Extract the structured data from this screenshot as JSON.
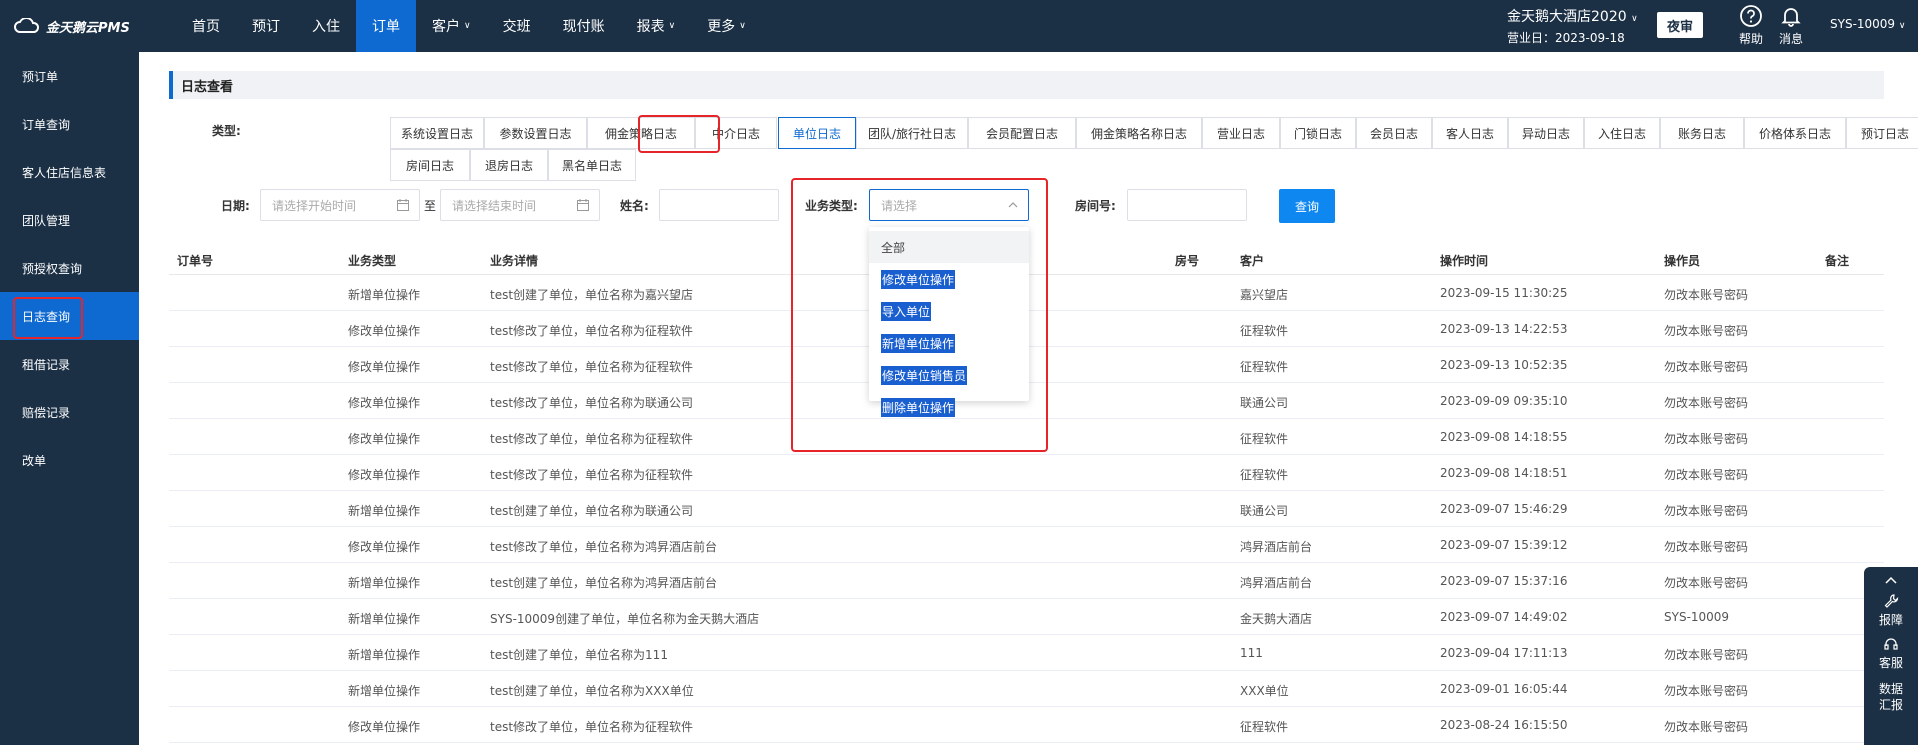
{
  "brand": {
    "logo_text": "金天鹅云PMS"
  },
  "nav": {
    "items": [
      {
        "label": "首页",
        "active": false,
        "has_dropdown": false
      },
      {
        "label": "预订",
        "active": false,
        "has_dropdown": false
      },
      {
        "label": "入住",
        "active": false,
        "has_dropdown": false
      },
      {
        "label": "订单",
        "active": true,
        "has_dropdown": false
      },
      {
        "label": "客户",
        "active": false,
        "has_dropdown": true
      },
      {
        "label": "交班",
        "active": false,
        "has_dropdown": false
      },
      {
        "label": "现付账",
        "active": false,
        "has_dropdown": false
      },
      {
        "label": "报表",
        "active": false,
        "has_dropdown": true
      },
      {
        "label": "更多",
        "active": false,
        "has_dropdown": true
      }
    ]
  },
  "header": {
    "hotel_name": "金天鹅大酒店2020",
    "business_date": "营业日：2023-09-18",
    "night_audit_label": "夜审",
    "help_label": "帮助",
    "message_label": "消息",
    "user_label": "SYS-10009"
  },
  "sidebar": {
    "items": [
      {
        "label": "预订单",
        "active": false
      },
      {
        "label": "订单查询",
        "active": false
      },
      {
        "label": "客人住店信息表",
        "active": false
      },
      {
        "label": "团队管理",
        "active": false
      },
      {
        "label": "预授权查询",
        "active": false
      },
      {
        "label": "日志查询",
        "active": true
      },
      {
        "label": "租借记录",
        "active": false
      },
      {
        "label": "赔偿记录",
        "active": false
      },
      {
        "label": "改单",
        "active": false
      }
    ]
  },
  "page": {
    "title": "日志查看",
    "type_label": "类型:",
    "types": [
      "系统设置日志",
      "参数设置日志",
      "佣金策略日志",
      "中介日志",
      "单位日志",
      "团队/旅行社日志",
      "会员配置日志",
      "佣金策略名称日志",
      "营业日志",
      "门锁日志",
      "会员日志",
      "客人日志",
      "异动日志",
      "入住日志",
      "账务日志",
      "价格体系日志",
      "预订日志",
      "房间日志",
      "退房日志",
      "黑名单日志"
    ],
    "active_type": "单位日志"
  },
  "filters": {
    "date_label": "日期:",
    "start_placeholder": "请选择开始时间",
    "to_label": "至",
    "end_placeholder": "请选择结束时间",
    "name_label": "姓名:",
    "biz_type_label": "业务类型:",
    "biz_type_placeholder": "请选择",
    "room_label": "房间号:",
    "query_label": "查询"
  },
  "dropdown": {
    "options": [
      "全部",
      "修改单位操作",
      "导入单位",
      "新增单位操作",
      "修改单位销售员",
      "删除单位操作"
    ]
  },
  "table": {
    "headers": {
      "order_no": "订单号",
      "biz_type": "业务类型",
      "biz_detail": "业务详情",
      "room": "房号",
      "customer": "客户",
      "op_time": "操作时间",
      "operator": "操作员",
      "remark": "备注"
    },
    "rows": [
      {
        "biz_type": "新增单位操作",
        "biz_detail": "test创建了单位，单位名称为嘉兴望店",
        "customer": "嘉兴望店",
        "op_time": "2023-09-15 11:30:25",
        "operator": "勿改本账号密码"
      },
      {
        "biz_type": "修改单位操作",
        "biz_detail": "test修改了单位，单位名称为征程软件",
        "customer": "征程软件",
        "op_time": "2023-09-13 14:22:53",
        "operator": "勿改本账号密码"
      },
      {
        "biz_type": "修改单位操作",
        "biz_detail": "test修改了单位，单位名称为征程软件",
        "customer": "征程软件",
        "op_time": "2023-09-13 10:52:35",
        "operator": "勿改本账号密码"
      },
      {
        "biz_type": "修改单位操作",
        "biz_detail": "test修改了单位，单位名称为联通公司",
        "customer": "联通公司",
        "op_time": "2023-09-09 09:35:10",
        "operator": "勿改本账号密码"
      },
      {
        "biz_type": "修改单位操作",
        "biz_detail": "test修改了单位，单位名称为征程软件",
        "customer": "征程软件",
        "op_time": "2023-09-08 14:18:55",
        "operator": "勿改本账号密码"
      },
      {
        "biz_type": "修改单位操作",
        "biz_detail": "test修改了单位，单位名称为征程软件",
        "customer": "征程软件",
        "op_time": "2023-09-08 14:18:51",
        "operator": "勿改本账号密码"
      },
      {
        "biz_type": "新增单位操作",
        "biz_detail": "test创建了单位，单位名称为联通公司",
        "customer": "联通公司",
        "op_time": "2023-09-07 15:46:29",
        "operator": "勿改本账号密码"
      },
      {
        "biz_type": "修改单位操作",
        "biz_detail": "test修改了单位，单位名称为鸿昇酒店前台",
        "customer": "鸿昇酒店前台",
        "op_time": "2023-09-07 15:39:12",
        "operator": "勿改本账号密码"
      },
      {
        "biz_type": "新增单位操作",
        "biz_detail": "test创建了单位，单位名称为鸿昇酒店前台",
        "customer": "鸿昇酒店前台",
        "op_time": "2023-09-07 15:37:16",
        "operator": "勿改本账号密码"
      },
      {
        "biz_type": "新增单位操作",
        "biz_detail": "SYS-10009创建了单位，单位名称为金天鹅大酒店",
        "customer": "金天鹅大酒店",
        "op_time": "2023-09-07 14:49:02",
        "operator": "SYS-10009"
      },
      {
        "biz_type": "新增单位操作",
        "biz_detail": "test创建了单位，单位名称为111",
        "customer": "111",
        "op_time": "2023-09-04 17:11:13",
        "operator": "勿改本账号密码"
      },
      {
        "biz_type": "新增单位操作",
        "biz_detail": "test创建了单位，单位名称为XXX单位",
        "customer": "XXX单位",
        "op_time": "2023-09-01 16:05:44",
        "operator": "勿改本账号密码"
      },
      {
        "biz_type": "修改单位操作",
        "biz_detail": "test修改了单位，单位名称为征程软件",
        "customer": "征程软件",
        "op_time": "2023-08-24 16:15:50",
        "operator": "勿改本账号密码"
      }
    ]
  },
  "float_panel": {
    "items": [
      "报障",
      "客服",
      "数据\n汇报"
    ]
  },
  "colors": {
    "topbar": "#1b2f45",
    "accent": "#0e6ad1",
    "highlight": "#e5252a"
  }
}
